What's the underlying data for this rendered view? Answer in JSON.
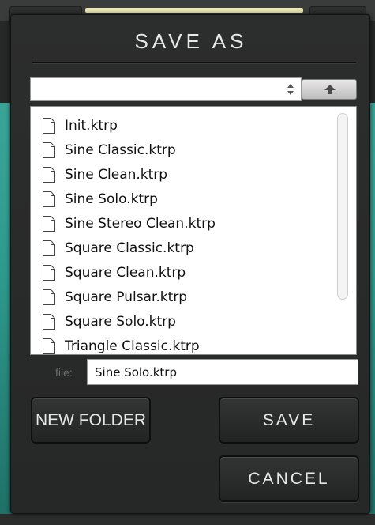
{
  "dialog": {
    "title": "SAVE AS",
    "location": {
      "value": ""
    },
    "file_list": {
      "items": [
        {
          "name": "Init.ktrp"
        },
        {
          "name": "Sine Classic.ktrp"
        },
        {
          "name": "Sine Clean.ktrp"
        },
        {
          "name": "Sine Solo.ktrp"
        },
        {
          "name": "Sine Stereo Clean.ktrp"
        },
        {
          "name": "Square Classic.ktrp"
        },
        {
          "name": "Square Clean.ktrp"
        },
        {
          "name": "Square Pulsar.ktrp"
        },
        {
          "name": "Square Solo.ktrp"
        },
        {
          "name": "Triangle Classic.ktrp"
        }
      ]
    },
    "file_field": {
      "label": "file:",
      "value": "Sine Solo.ktrp"
    },
    "buttons": {
      "new_folder": "NEW FOLDER",
      "save": "SAVE",
      "cancel": "CANCEL"
    }
  },
  "colors": {
    "dialog_bg": "#2c2d2d",
    "text_light": "#e9e9e9",
    "accent_teal": "#3aa497",
    "accent_yellow": "#ece7b4"
  },
  "icons": {
    "up_button": "arrow-up-icon",
    "file": "document-icon",
    "select": "chevron-up-down-icon"
  }
}
